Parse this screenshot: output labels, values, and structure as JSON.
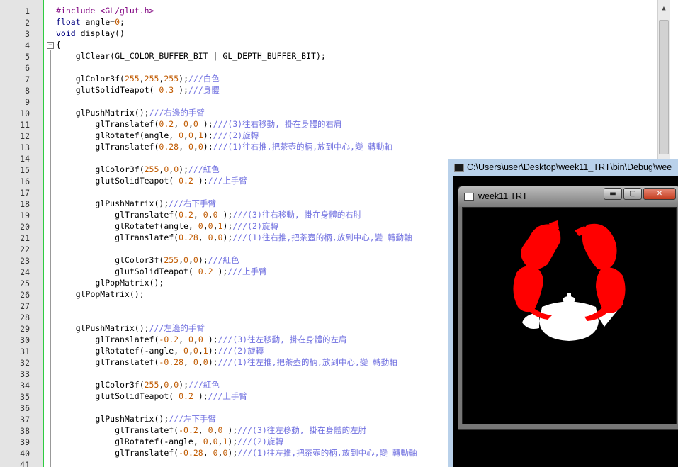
{
  "editor": {
    "lines": [
      {
        "n": "1",
        "t": [
          [
            "p",
            "#include <GL/glut.h>"
          ]
        ]
      },
      {
        "n": "2",
        "t": [
          [
            "k",
            "float"
          ],
          [
            "f",
            " angle="
          ],
          [
            "n",
            "0"
          ],
          [
            "f",
            ";"
          ]
        ]
      },
      {
        "n": "3",
        "t": [
          [
            "k",
            "void"
          ],
          [
            "f",
            " display()"
          ]
        ]
      },
      {
        "n": "4",
        "t": [
          [
            "f",
            "{"
          ]
        ]
      },
      {
        "n": "5",
        "t": [
          [
            "f",
            "    glClear(GL_COLOR_BUFFER_BIT | GL_DEPTH_BUFFER_BIT);"
          ]
        ]
      },
      {
        "n": "6",
        "t": []
      },
      {
        "n": "7",
        "t": [
          [
            "f",
            "    glColor3f("
          ],
          [
            "n",
            "255"
          ],
          [
            "f",
            ","
          ],
          [
            "n",
            "255"
          ],
          [
            "f",
            ","
          ],
          [
            "n",
            "255"
          ],
          [
            "f",
            ");"
          ],
          [
            "c",
            "///白色"
          ]
        ]
      },
      {
        "n": "8",
        "t": [
          [
            "f",
            "    glutSolidTeapot( "
          ],
          [
            "n",
            "0.3"
          ],
          [
            "f",
            " );"
          ],
          [
            "c",
            "///身體"
          ]
        ]
      },
      {
        "n": "9",
        "t": []
      },
      {
        "n": "10",
        "t": [
          [
            "f",
            "    glPushMatrix();"
          ],
          [
            "c",
            "///右邊的手臂"
          ]
        ]
      },
      {
        "n": "11",
        "t": [
          [
            "f",
            "        glTranslatef("
          ],
          [
            "n",
            "0.2"
          ],
          [
            "f",
            ", "
          ],
          [
            "n",
            "0"
          ],
          [
            "f",
            ","
          ],
          [
            "n",
            "0"
          ],
          [
            "f",
            " );"
          ],
          [
            "c",
            "///(3)往右移動, 掛在身體的右肩"
          ]
        ]
      },
      {
        "n": "12",
        "t": [
          [
            "f",
            "        glRotatef(angle, "
          ],
          [
            "n",
            "0"
          ],
          [
            "f",
            ","
          ],
          [
            "n",
            "0"
          ],
          [
            "f",
            ","
          ],
          [
            "n",
            "1"
          ],
          [
            "f",
            ");"
          ],
          [
            "c",
            "///(2)旋轉"
          ]
        ]
      },
      {
        "n": "13",
        "t": [
          [
            "f",
            "        glTranslatef("
          ],
          [
            "n",
            "0.28"
          ],
          [
            "f",
            ", "
          ],
          [
            "n",
            "0"
          ],
          [
            "f",
            ","
          ],
          [
            "n",
            "0"
          ],
          [
            "f",
            ");"
          ],
          [
            "c",
            "///(1)往右推,把茶壺的柄,放到中心,變 轉動軸"
          ]
        ]
      },
      {
        "n": "14",
        "t": []
      },
      {
        "n": "15",
        "t": [
          [
            "f",
            "        glColor3f("
          ],
          [
            "n",
            "255"
          ],
          [
            "f",
            ","
          ],
          [
            "n",
            "0"
          ],
          [
            "f",
            ","
          ],
          [
            "n",
            "0"
          ],
          [
            "f",
            ");"
          ],
          [
            "c",
            "///紅色"
          ]
        ]
      },
      {
        "n": "16",
        "t": [
          [
            "f",
            "        glutSolidTeapot( "
          ],
          [
            "n",
            "0.2"
          ],
          [
            "f",
            " );"
          ],
          [
            "c",
            "///上手臂"
          ]
        ]
      },
      {
        "n": "17",
        "t": []
      },
      {
        "n": "18",
        "t": [
          [
            "f",
            "        glPushMatrix();"
          ],
          [
            "c",
            "///右下手臂"
          ]
        ]
      },
      {
        "n": "19",
        "t": [
          [
            "f",
            "            glTranslatef("
          ],
          [
            "n",
            "0.2"
          ],
          [
            "f",
            ", "
          ],
          [
            "n",
            "0"
          ],
          [
            "f",
            ","
          ],
          [
            "n",
            "0"
          ],
          [
            "f",
            " );"
          ],
          [
            "c",
            "///(3)往右移動, 掛在身體的右肘"
          ]
        ]
      },
      {
        "n": "20",
        "t": [
          [
            "f",
            "            glRotatef(angle, "
          ],
          [
            "n",
            "0"
          ],
          [
            "f",
            ","
          ],
          [
            "n",
            "0"
          ],
          [
            "f",
            ","
          ],
          [
            "n",
            "1"
          ],
          [
            "f",
            ");"
          ],
          [
            "c",
            "///(2)旋轉"
          ]
        ]
      },
      {
        "n": "21",
        "t": [
          [
            "f",
            "            glTranslatef("
          ],
          [
            "n",
            "0.28"
          ],
          [
            "f",
            ", "
          ],
          [
            "n",
            "0"
          ],
          [
            "f",
            ","
          ],
          [
            "n",
            "0"
          ],
          [
            "f",
            ");"
          ],
          [
            "c",
            "///(1)往右推,把茶壺的柄,放到中心,變 轉動軸"
          ]
        ]
      },
      {
        "n": "22",
        "t": []
      },
      {
        "n": "23",
        "t": [
          [
            "f",
            "            glColor3f("
          ],
          [
            "n",
            "255"
          ],
          [
            "f",
            ","
          ],
          [
            "n",
            "0"
          ],
          [
            "f",
            ","
          ],
          [
            "n",
            "0"
          ],
          [
            "f",
            ");"
          ],
          [
            "c",
            "///紅色"
          ]
        ]
      },
      {
        "n": "24",
        "t": [
          [
            "f",
            "            glutSolidTeapot( "
          ],
          [
            "n",
            "0.2"
          ],
          [
            "f",
            " );"
          ],
          [
            "c",
            "///上手臂"
          ]
        ]
      },
      {
        "n": "25",
        "t": [
          [
            "f",
            "        glPopMatrix();"
          ]
        ]
      },
      {
        "n": "26",
        "t": [
          [
            "f",
            "    glPopMatrix();"
          ]
        ]
      },
      {
        "n": "27",
        "t": []
      },
      {
        "n": "28",
        "t": []
      },
      {
        "n": "29",
        "t": [
          [
            "f",
            "    glPushMatrix();"
          ],
          [
            "c",
            "///左邊的手臂"
          ]
        ]
      },
      {
        "n": "30",
        "t": [
          [
            "f",
            "        glTranslatef("
          ],
          [
            "n",
            "-0.2"
          ],
          [
            "f",
            ", "
          ],
          [
            "n",
            "0"
          ],
          [
            "f",
            ","
          ],
          [
            "n",
            "0"
          ],
          [
            "f",
            " );"
          ],
          [
            "c",
            "///(3)往左移動, 掛在身體的左肩"
          ]
        ]
      },
      {
        "n": "31",
        "t": [
          [
            "f",
            "        glRotatef(-angle, "
          ],
          [
            "n",
            "0"
          ],
          [
            "f",
            ","
          ],
          [
            "n",
            "0"
          ],
          [
            "f",
            ","
          ],
          [
            "n",
            "1"
          ],
          [
            "f",
            ");"
          ],
          [
            "c",
            "///(2)旋轉"
          ]
        ]
      },
      {
        "n": "32",
        "t": [
          [
            "f",
            "        glTranslatef("
          ],
          [
            "n",
            "-0.28"
          ],
          [
            "f",
            ", "
          ],
          [
            "n",
            "0"
          ],
          [
            "f",
            ","
          ],
          [
            "n",
            "0"
          ],
          [
            "f",
            ");"
          ],
          [
            "c",
            "///(1)往左推,把茶壺的柄,放到中心,變 轉動軸"
          ]
        ]
      },
      {
        "n": "33",
        "t": []
      },
      {
        "n": "34",
        "t": [
          [
            "f",
            "        glColor3f("
          ],
          [
            "n",
            "255"
          ],
          [
            "f",
            ","
          ],
          [
            "n",
            "0"
          ],
          [
            "f",
            ","
          ],
          [
            "n",
            "0"
          ],
          [
            "f",
            ");"
          ],
          [
            "c",
            "///紅色"
          ]
        ]
      },
      {
        "n": "35",
        "t": [
          [
            "f",
            "        glutSolidTeapot( "
          ],
          [
            "n",
            "0.2"
          ],
          [
            "f",
            " );"
          ],
          [
            "c",
            "///上手臂"
          ]
        ]
      },
      {
        "n": "36",
        "t": []
      },
      {
        "n": "37",
        "t": [
          [
            "f",
            "        glPushMatrix();"
          ],
          [
            "c",
            "///左下手臂"
          ]
        ]
      },
      {
        "n": "38",
        "t": [
          [
            "f",
            "            glTranslatef("
          ],
          [
            "n",
            "-0.2"
          ],
          [
            "f",
            ", "
          ],
          [
            "n",
            "0"
          ],
          [
            "f",
            ","
          ],
          [
            "n",
            "0"
          ],
          [
            "f",
            " );"
          ],
          [
            "c",
            "///(3)往左移動, 掛在身體的左肘"
          ]
        ]
      },
      {
        "n": "39",
        "t": [
          [
            "f",
            "            glRotatef(-angle, "
          ],
          [
            "n",
            "0"
          ],
          [
            "f",
            ","
          ],
          [
            "n",
            "0"
          ],
          [
            "f",
            ","
          ],
          [
            "n",
            "1"
          ],
          [
            "f",
            ");"
          ],
          [
            "c",
            "///(2)旋轉"
          ]
        ]
      },
      {
        "n": "40",
        "t": [
          [
            "f",
            "            glTranslatef("
          ],
          [
            "n",
            "-0.28"
          ],
          [
            "f",
            ", "
          ],
          [
            "n",
            "0"
          ],
          [
            "f",
            ","
          ],
          [
            "n",
            "0"
          ],
          [
            "f",
            ");"
          ],
          [
            "c",
            "///(1)往左推,把茶壺的柄,放到中心,變 轉動軸"
          ]
        ]
      },
      {
        "n": "41",
        "t": []
      }
    ]
  },
  "console_window": {
    "title": "C:\\Users\\user\\Desktop\\week11_TRT\\bin\\Debug\\wee"
  },
  "glut_window": {
    "title": "week11 TRT",
    "minimize_glyph": "▬",
    "maximize_glyph": "▢",
    "close_glyph": "✕",
    "body_color": "#ffffff",
    "arm_color": "#ff0000"
  },
  "colors": {
    "change_bar": "#2ecc40",
    "gutter": "#e4e4e4"
  }
}
